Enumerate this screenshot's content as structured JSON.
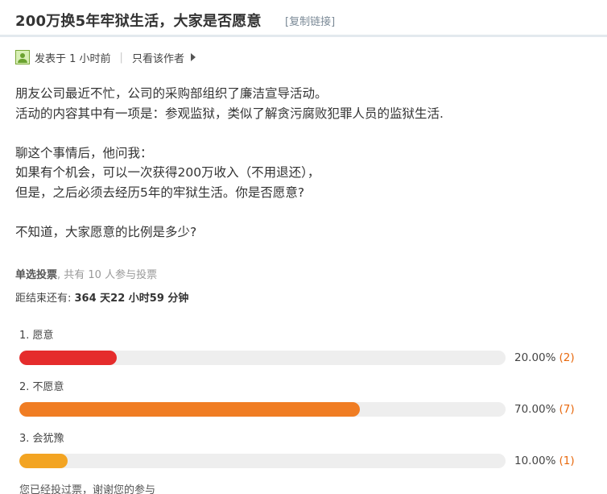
{
  "thread": {
    "title": "200万换5年牢狱生活，大家是否愿意",
    "copy_link": "[复制链接]"
  },
  "meta": {
    "posted": "发表于 1 小时前",
    "separator": "|",
    "author_only": "只看该作者"
  },
  "post": {
    "lines": [
      "朋友公司最近不忙，公司的采购部组织了廉洁宣导活动。",
      "活动的内容其中有一项是：参观监狱，类似了解贪污腐败犯罪人员的监狱生活.",
      "",
      "聊这个事情后，他问我：",
      "如果有个机会，可以一次获得200万收入（不用退还），",
      "但是，之后必须去经历5年的牢狱生活。你是否愿意?",
      "",
      "不知道，大家愿意的比例是多少?"
    ]
  },
  "poll": {
    "type_label": "单选投票",
    "participants": ", 共有 10 人参与投票",
    "deadline_label": "距结束还有: ",
    "deadline_value": "364 天22 小时59 分钟",
    "options": [
      {
        "label": "1.  愿意",
        "percent_text": "20.00%",
        "count_text": "(2)",
        "fraction": 0.2,
        "color": "#e52c2c"
      },
      {
        "label": "2.  不愿意",
        "percent_text": "70.00%",
        "count_text": "(7)",
        "fraction": 0.7,
        "color": "#f07d23"
      },
      {
        "label": "3.  会犹豫",
        "percent_text": "10.00%",
        "count_text": "(1)",
        "fraction": 0.1,
        "color": "#f3a422"
      }
    ],
    "count_color": "#e8690e",
    "voted_note": "您已经投过票，谢谢您的参与"
  }
}
